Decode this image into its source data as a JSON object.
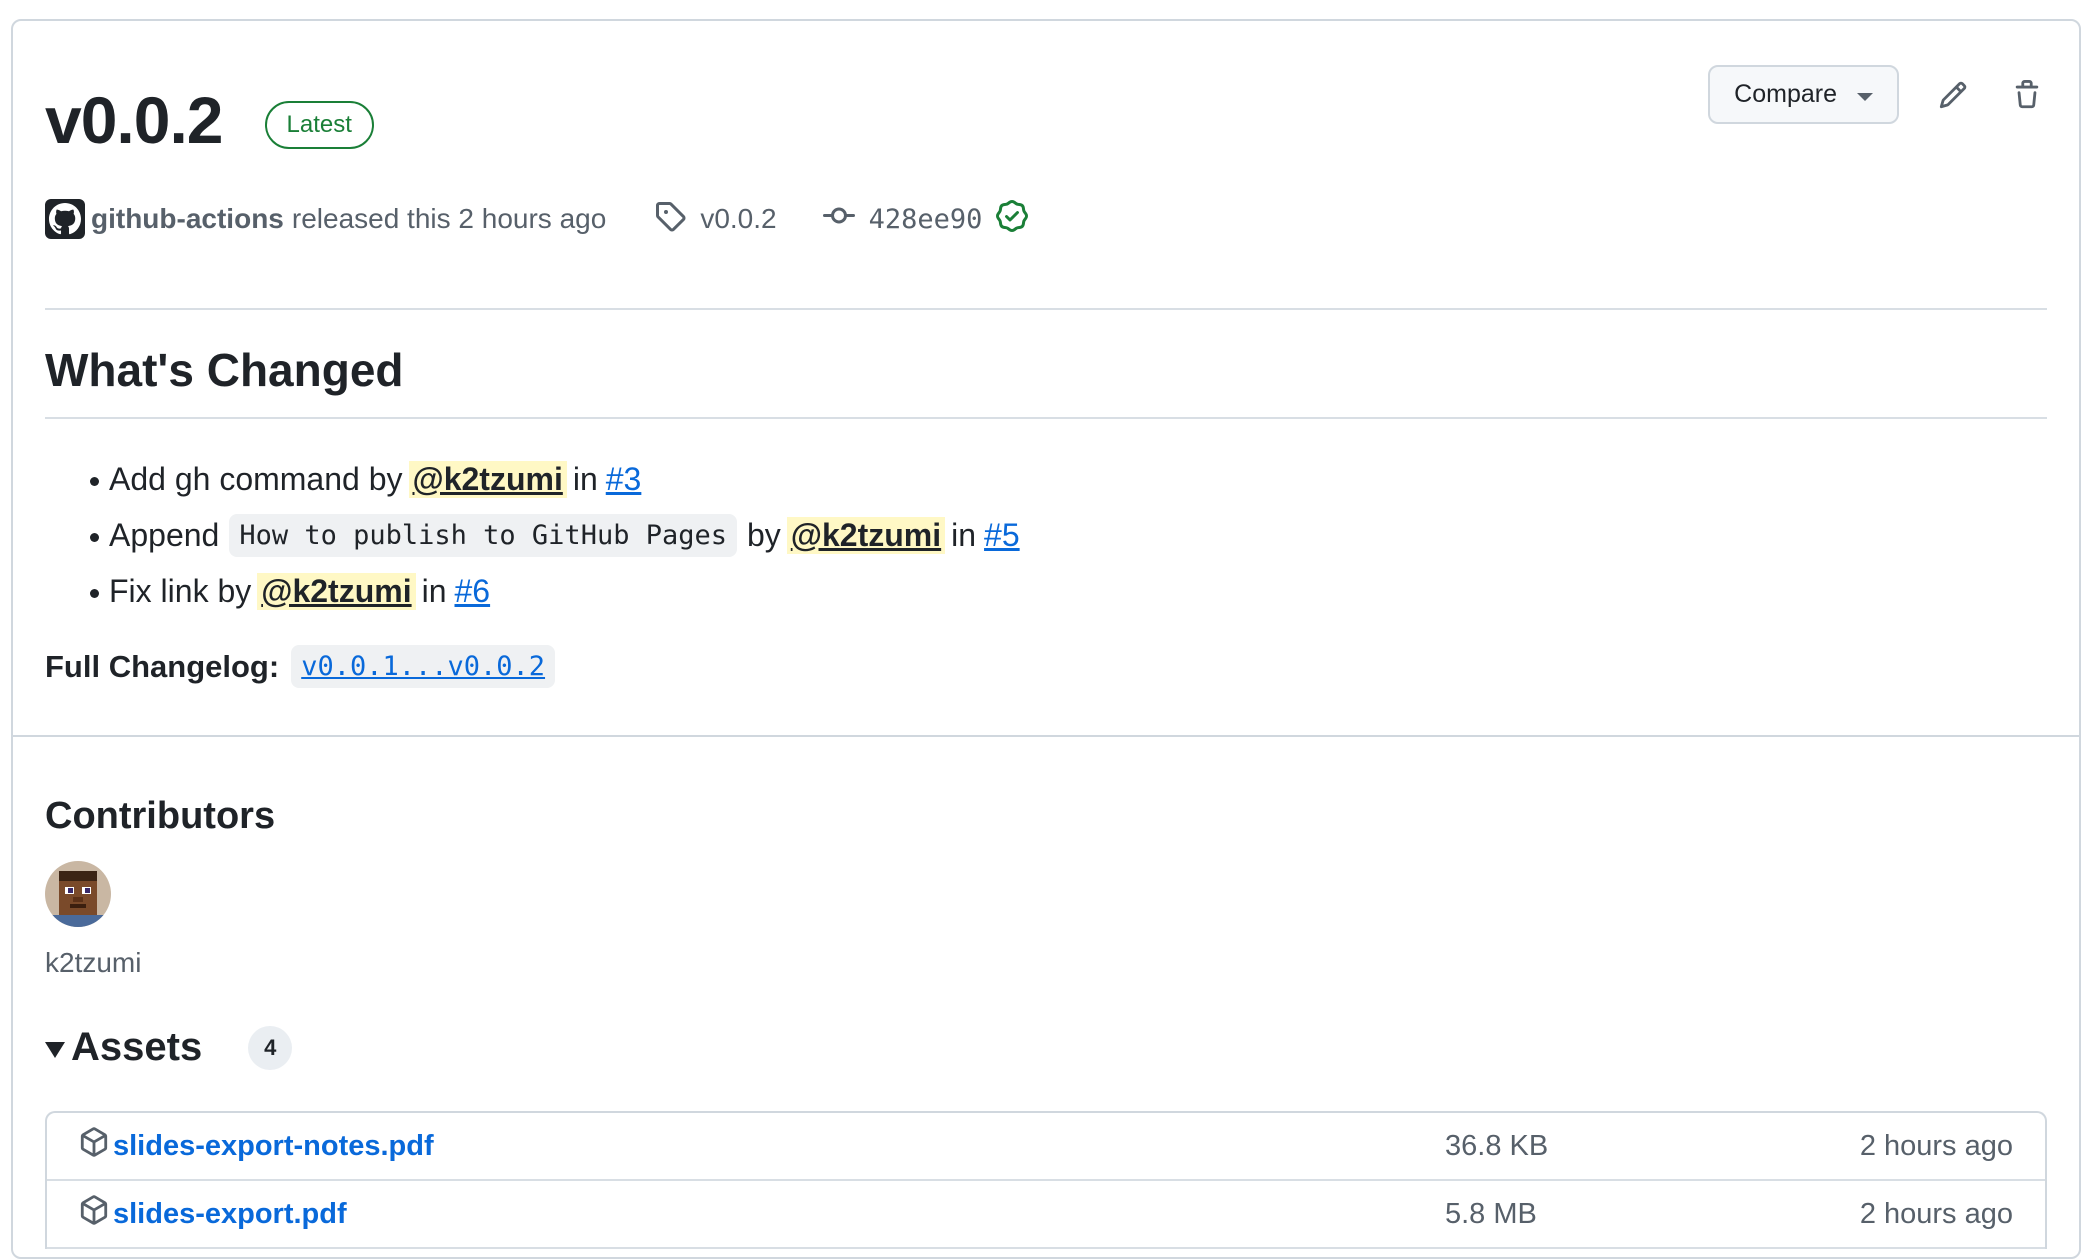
{
  "release": {
    "version": "v0.0.2",
    "badge": "Latest",
    "compare_label": "Compare",
    "author": "github-actions",
    "released_text": "released this 2 hours ago",
    "tag": "v0.0.2",
    "commit": "428ee90"
  },
  "notes": {
    "heading": "What's Changed",
    "items": [
      {
        "prefix": "Add gh command by",
        "code": "",
        "by": "",
        "mention": "@k2tzumi",
        "in": "in",
        "issue": "#3"
      },
      {
        "prefix": "Append",
        "code": "How to publish to GitHub Pages",
        "by": "by",
        "mention": "@k2tzumi",
        "in": "in",
        "issue": "#5"
      },
      {
        "prefix": "Fix link by",
        "code": "",
        "by": "",
        "mention": "@k2tzumi",
        "in": "in",
        "issue": "#6"
      }
    ],
    "full_changelog_label": "Full Changelog:",
    "full_changelog_link": "v0.0.1...v0.0.2"
  },
  "contributors": {
    "heading": "Contributors",
    "people": [
      {
        "name": "k2tzumi"
      }
    ]
  },
  "assets": {
    "heading": "Assets",
    "count": "4",
    "rows": [
      {
        "name": "slides-export-notes.pdf",
        "size": "36.8 KB",
        "time": "2 hours ago"
      },
      {
        "name": "slides-export.pdf",
        "size": "5.8 MB",
        "time": "2 hours ago"
      }
    ]
  },
  "icons": [
    "pencil-icon",
    "trash-icon",
    "tag-icon",
    "commit-icon",
    "verified-icon",
    "package-icon",
    "github-logo-icon"
  ],
  "colors": {
    "link": "#0969da",
    "success": "#1a7f37",
    "mention_bg": "#fff8c5",
    "muted": "#57606a"
  }
}
